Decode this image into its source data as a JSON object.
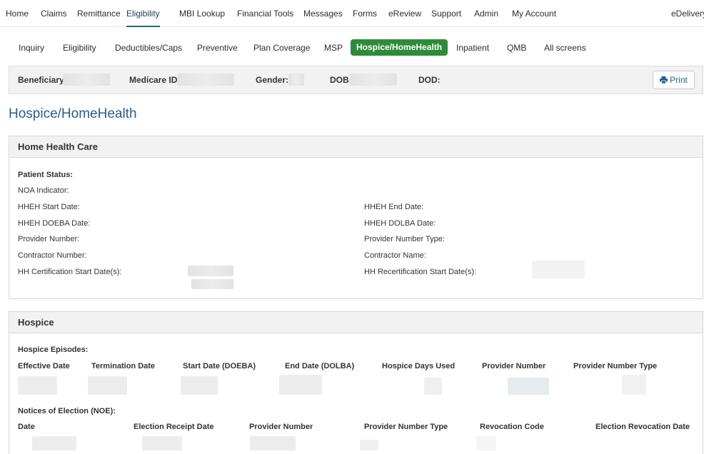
{
  "topnav": {
    "items": [
      "Home",
      "Claims",
      "Remittance",
      "Eligibility",
      "MBI Lookup",
      "Financial Tools",
      "Messages",
      "Forms",
      "eReview",
      "Support",
      "Admin",
      "My Account"
    ],
    "right": "eDelivery"
  },
  "subnav": {
    "items": [
      "Inquiry",
      "Eligibility",
      "Deductibles/Caps",
      "Preventive",
      "Plan Coverage",
      "MSP",
      "Hospice/HomeHealth",
      "Inpatient",
      "QMB",
      "All screens"
    ]
  },
  "beneficiary": {
    "beneficiary_label": "Beneficiary:",
    "medicare_label": "Medicare ID:",
    "gender_label": "Gender:",
    "dob_label": "DOB:",
    "dod_label": "DOD:",
    "print_label": "Print"
  },
  "page_title": "Hospice/HomeHealth",
  "home_health": {
    "title": "Home Health Care",
    "patient_status": "Patient Status:",
    "noa_indicator": "NOA Indicator:",
    "hheh_start": "HHEH Start Date:",
    "hheh_end": "HHEH End Date:",
    "hheh_doeba": "HHEH DOEBA Date:",
    "hheh_dolba": "HHEH DOLBA Date:",
    "provider_number": "Provider Number:",
    "provider_number_type": "Provider Number Type:",
    "contractor_number": "Contractor Number:",
    "contractor_name": "Contractor Name:",
    "hh_cert_start": "HH Certification Start Date(s):",
    "hh_recert_start": "HH Recertification Start Date(s):"
  },
  "hospice": {
    "title": "Hospice",
    "episodes_label": "Hospice Episodes:",
    "episode_columns": [
      "Effective Date",
      "Termination Date",
      "Start Date (DOEBA)",
      "End Date (DOLBA)",
      "Hospice Days Used",
      "Provider Number",
      "Provider Number Type"
    ],
    "noe_label": "Notices of Election (NOE):",
    "noe_columns": [
      "Date",
      "Election Receipt Date",
      "Provider Number",
      "Provider Number Type",
      "Revocation Code",
      "Election Revocation Date"
    ]
  },
  "colors": {
    "active_tab": "#2e8b3a",
    "title_blue": "#2b5d8a",
    "link_blue": "#1e5f8e"
  }
}
